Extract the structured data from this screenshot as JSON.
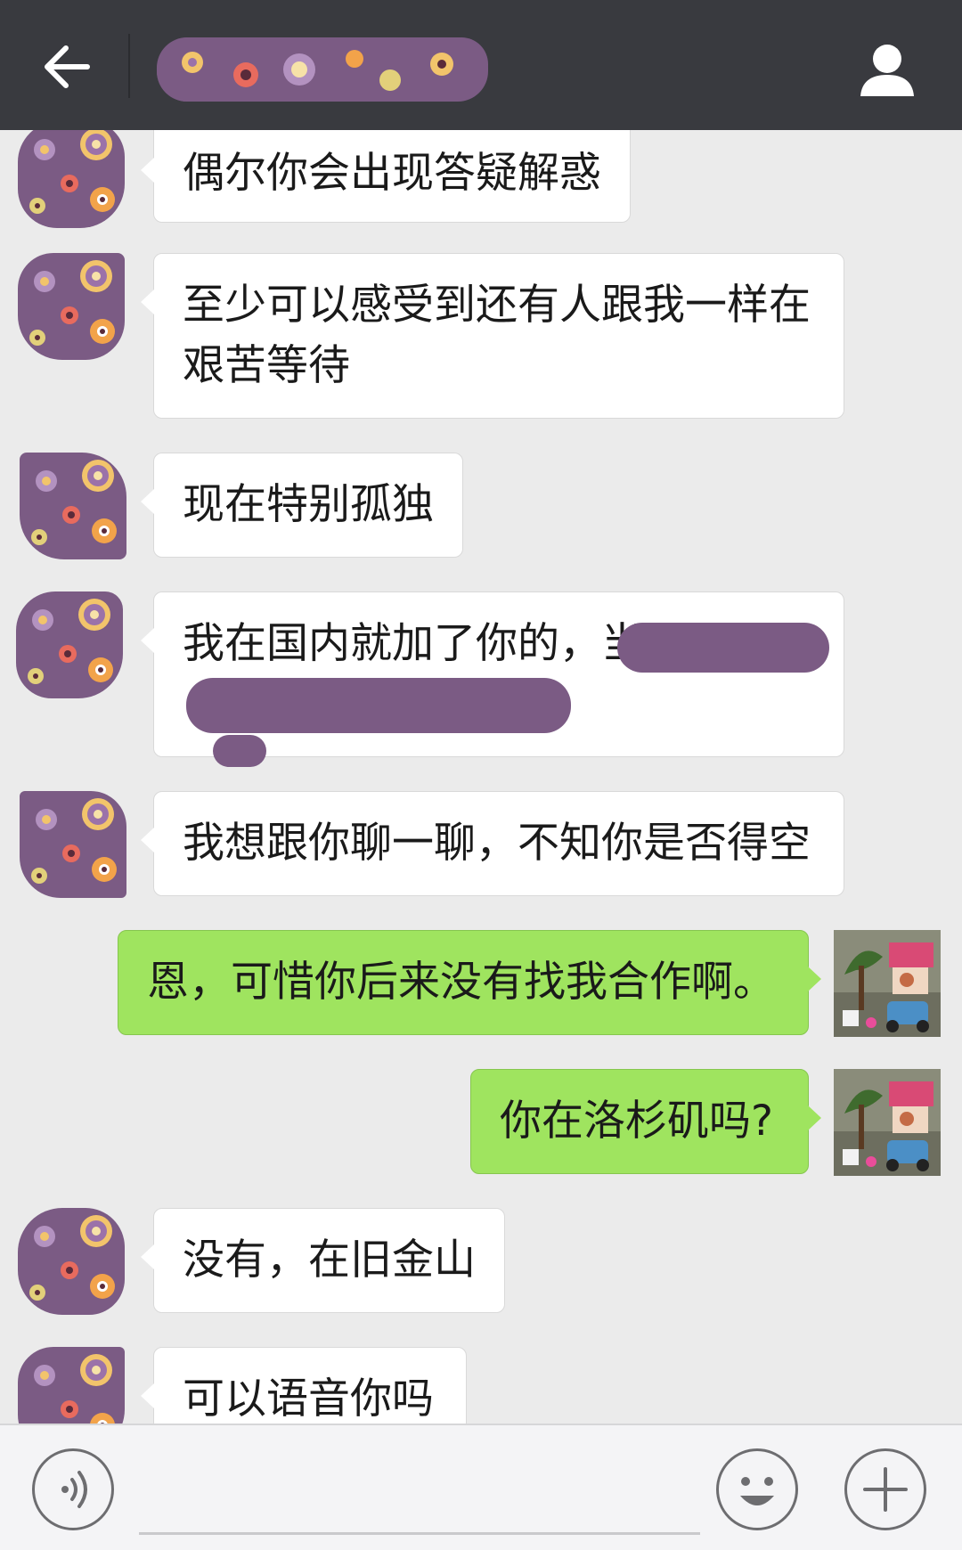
{
  "header": {
    "title_redacted": true,
    "back_icon": "back-arrow-icon",
    "profile_icon": "person-icon"
  },
  "messages": [
    {
      "side": "in",
      "text": "偶尔你会出现答疑解惑"
    },
    {
      "side": "in",
      "lines": [
        "至少可以感受到还有人跟我一样在",
        "艰苦等待"
      ]
    },
    {
      "side": "in",
      "text": "现在特别孤独"
    },
    {
      "side": "in",
      "text_visible": "我在国内就加了你的，当",
      "partially_redacted": true
    },
    {
      "side": "in",
      "text": "我想跟你聊一聊，不知你是否得空"
    },
    {
      "side": "out",
      "text": "恩，可惜你后来没有找我合作啊。"
    },
    {
      "side": "out",
      "text": "你在洛杉矶吗?"
    },
    {
      "side": "in",
      "text": "没有，在旧金山"
    },
    {
      "side": "in",
      "text": "可以语音你吗"
    }
  ],
  "input_bar": {
    "voice_icon": "voice-icon",
    "emoji_icon": "emoji-icon",
    "plus_icon": "plus-icon",
    "placeholder": ""
  },
  "colors": {
    "header_bg": "#393a3f",
    "chat_bg": "#ebebeb",
    "incoming_bubble": "#ffffff",
    "outgoing_bubble": "#9fe45f",
    "redaction": "#7b5b84"
  }
}
